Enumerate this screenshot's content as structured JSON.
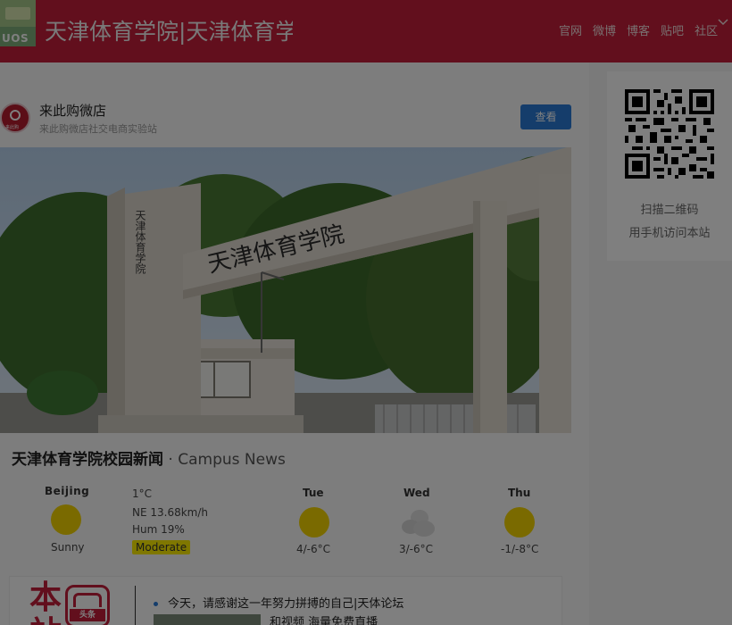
{
  "header": {
    "logo_text": "UOS",
    "site_title": "天津体育学院|天津体育学院",
    "nav": [
      "官网",
      "微博",
      "博客",
      "贴吧",
      "社区"
    ]
  },
  "shop": {
    "avatar_text": "来此购",
    "name": "来此购微店",
    "description": "来此购微店社交电商实验站",
    "view_label": "查看"
  },
  "photo": {
    "gate_text": "天津体育学院",
    "pillar_text": "天津体育学院"
  },
  "news": {
    "title_cn": "天津体育学院校园新闻",
    "title_sep": " · ",
    "title_en": "Campus News"
  },
  "weather": {
    "city": "Beijing",
    "condition": "Sunny",
    "temp": "1°C",
    "wind": "NE 13.68km/h",
    "humidity": "Hum 19%",
    "aqi": "Moderate",
    "forecast": [
      {
        "day": "Tue",
        "range": "4/-6°C",
        "icon": "sun-icon"
      },
      {
        "day": "Wed",
        "range": "3/-6°C",
        "icon": "cloud-icon"
      },
      {
        "day": "Thu",
        "range": "-1/-8°C",
        "icon": "sun-icon"
      }
    ]
  },
  "headline": {
    "big_char_1": "本",
    "big_char_2": "站",
    "badge_label": "头条",
    "item_1": "今天，请感谢这一年努力拼搏的自己|天体论坛",
    "item_2": "和视频 海量免费直播"
  },
  "qr": {
    "line1": "扫描二维码",
    "line2": "用手机访问本站"
  },
  "colors": {
    "brand_red": "#c41e3a",
    "button_blue": "#2b7bd6",
    "aqi_yellow": "#ffee00",
    "sun_yellow": "#f5d400"
  }
}
